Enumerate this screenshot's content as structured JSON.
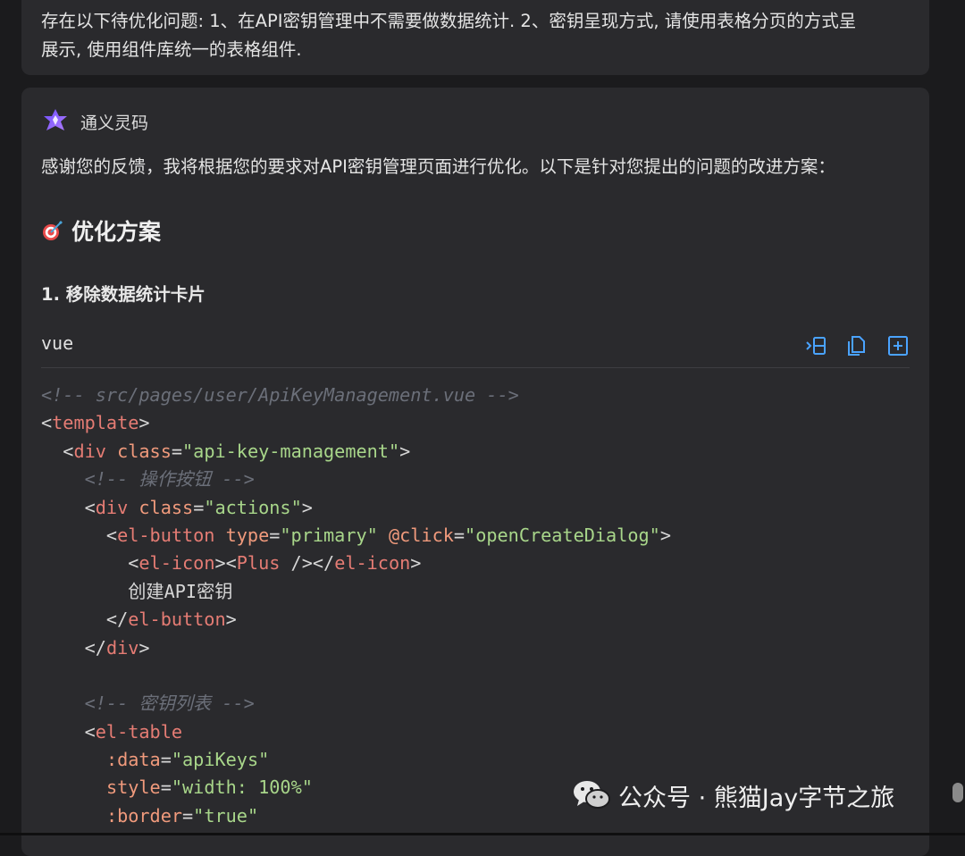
{
  "user_message": "存在以下待优化问题: 1、在API密钥管理中不需要做数据统计. 2、密钥呈现方式, 请使用表格分页的方式呈\n展示, 使用组件库统一的表格组件.",
  "assistant": {
    "name": "通义灵码",
    "intro": "感谢您的反馈，我将根据您的要求对API密钥管理页面进行优化。以下是针对您提出的问题的改进方案：",
    "section_title": "优化方案",
    "subsection_title": "1. 移除数据统计卡片"
  },
  "code_block": {
    "language": "vue",
    "actions": [
      "insert-icon",
      "copy-icon",
      "new-file-icon"
    ],
    "lines": [
      [
        {
          "t": "<!-- src/pages/user/ApiKeyManagement.vue -->",
          "c": "comment"
        }
      ],
      [
        {
          "t": "<",
          "c": "punc"
        },
        {
          "t": "template",
          "c": "tag"
        },
        {
          "t": ">",
          "c": "punc"
        }
      ],
      [
        {
          "t": "  <",
          "c": "punc"
        },
        {
          "t": "div",
          "c": "tag"
        },
        {
          "t": " ",
          "c": "text"
        },
        {
          "t": "class",
          "c": "attr"
        },
        {
          "t": "=",
          "c": "punc"
        },
        {
          "t": "\"api-key-management\"",
          "c": "str"
        },
        {
          "t": ">",
          "c": "punc"
        }
      ],
      [
        {
          "t": "    <!-- 操作按钮 -->",
          "c": "comment"
        }
      ],
      [
        {
          "t": "    <",
          "c": "punc"
        },
        {
          "t": "div",
          "c": "tag"
        },
        {
          "t": " ",
          "c": "text"
        },
        {
          "t": "class",
          "c": "attr"
        },
        {
          "t": "=",
          "c": "punc"
        },
        {
          "t": "\"actions\"",
          "c": "str"
        },
        {
          "t": ">",
          "c": "punc"
        }
      ],
      [
        {
          "t": "      <",
          "c": "punc"
        },
        {
          "t": "el-button",
          "c": "tag"
        },
        {
          "t": " ",
          "c": "text"
        },
        {
          "t": "type",
          "c": "attr"
        },
        {
          "t": "=",
          "c": "punc"
        },
        {
          "t": "\"primary\"",
          "c": "str"
        },
        {
          "t": " ",
          "c": "text"
        },
        {
          "t": "@click",
          "c": "attr"
        },
        {
          "t": "=",
          "c": "punc"
        },
        {
          "t": "\"openCreateDialog\"",
          "c": "str"
        },
        {
          "t": ">",
          "c": "punc"
        }
      ],
      [
        {
          "t": "        <",
          "c": "punc"
        },
        {
          "t": "el-icon",
          "c": "tag"
        },
        {
          "t": "><",
          "c": "punc"
        },
        {
          "t": "Plus",
          "c": "tag"
        },
        {
          "t": " /></",
          "c": "punc"
        },
        {
          "t": "el-icon",
          "c": "tag"
        },
        {
          "t": ">",
          "c": "punc"
        }
      ],
      [
        {
          "t": "        创建API密钥",
          "c": "text"
        }
      ],
      [
        {
          "t": "      </",
          "c": "punc"
        },
        {
          "t": "el-button",
          "c": "tag"
        },
        {
          "t": ">",
          "c": "punc"
        }
      ],
      [
        {
          "t": "    </",
          "c": "punc"
        },
        {
          "t": "div",
          "c": "tag"
        },
        {
          "t": ">",
          "c": "punc"
        }
      ],
      [
        {
          "t": "",
          "c": "text"
        }
      ],
      [
        {
          "t": "    <!-- 密钥列表 -->",
          "c": "comment"
        }
      ],
      [
        {
          "t": "    <",
          "c": "punc"
        },
        {
          "t": "el-table",
          "c": "tag"
        }
      ],
      [
        {
          "t": "      ",
          "c": "text"
        },
        {
          "t": ":data",
          "c": "attr"
        },
        {
          "t": "=",
          "c": "punc"
        },
        {
          "t": "\"apiKeys\"",
          "c": "str"
        }
      ],
      [
        {
          "t": "      ",
          "c": "text"
        },
        {
          "t": "style",
          "c": "attr"
        },
        {
          "t": "=",
          "c": "punc"
        },
        {
          "t": "\"width: 100%\"",
          "c": "str"
        }
      ],
      [
        {
          "t": "      ",
          "c": "text"
        },
        {
          "t": ":border",
          "c": "attr"
        },
        {
          "t": "=",
          "c": "punc"
        },
        {
          "t": "\"true\"",
          "c": "str"
        }
      ]
    ]
  },
  "watermark": "公众号 · 熊猫Jay字节之旅",
  "colors": {
    "background": "#1b1b1d",
    "card": "#2a2a2d",
    "accent_icon": "#4aa3ff",
    "logo_start": "#6d4dff",
    "logo_end": "#a070ff"
  }
}
